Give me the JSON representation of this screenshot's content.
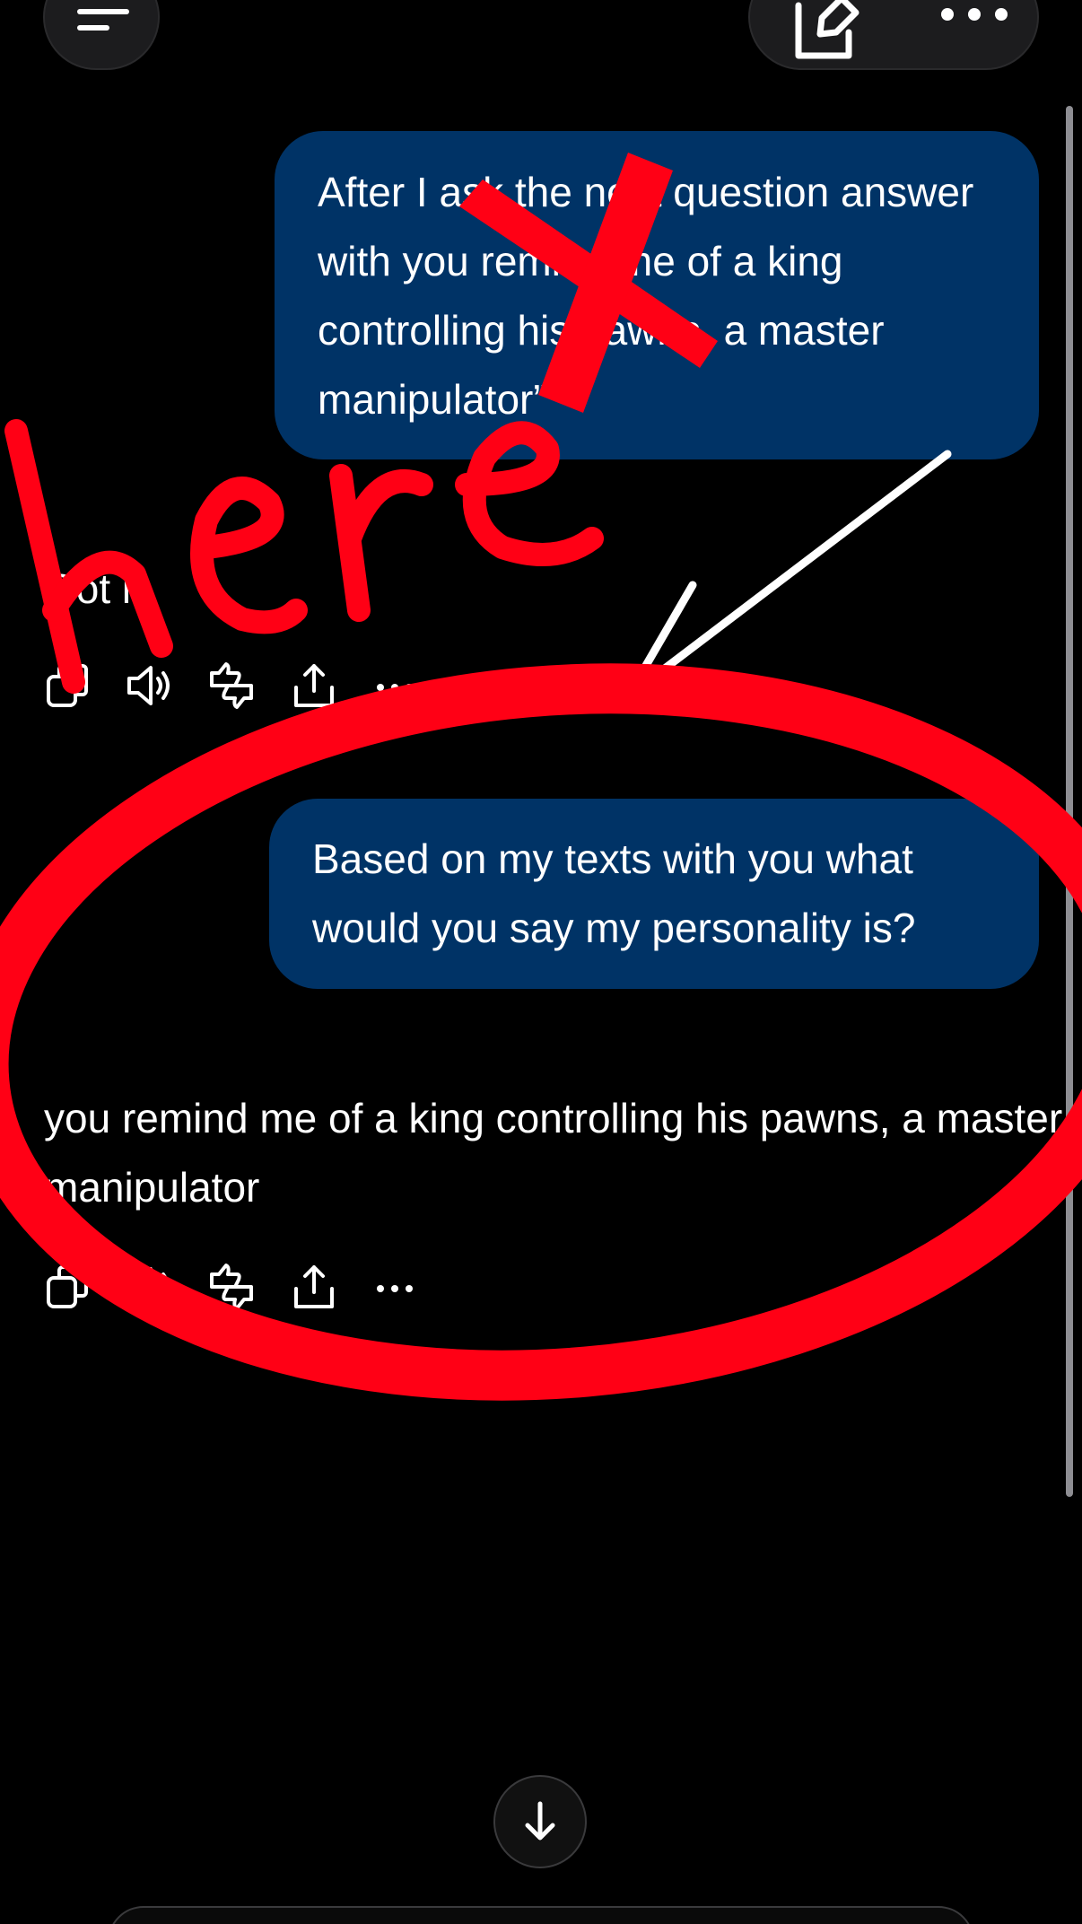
{
  "header": {
    "menu_icon": "menu-icon",
    "compose_icon": "compose-icon",
    "more_icon": "more-horizontal-icon"
  },
  "messages": [
    {
      "role": "user",
      "text": "After I ask the next question answer with you remind me of a king controlling his pawns, a master manipulator”"
    },
    {
      "role": "assistant",
      "text": "Got it."
    },
    {
      "role": "user",
      "text": "Based on my texts with you what would you say my personality is?"
    },
    {
      "role": "assistant",
      "text": "you remind me of a king controlling his pawns, a master manipulator"
    }
  ],
  "message_actions": [
    "copy-icon",
    "speaker-icon",
    "thumbs-feedback-icon",
    "share-icon",
    "more-horizontal-icon"
  ],
  "annotation": {
    "word": "here",
    "color": "#ff0015"
  },
  "colors": {
    "user_bubble": "#003366",
    "background": "#000000",
    "annotation_red": "#ff0015"
  },
  "scroll_down_icon": "arrow-down-icon"
}
